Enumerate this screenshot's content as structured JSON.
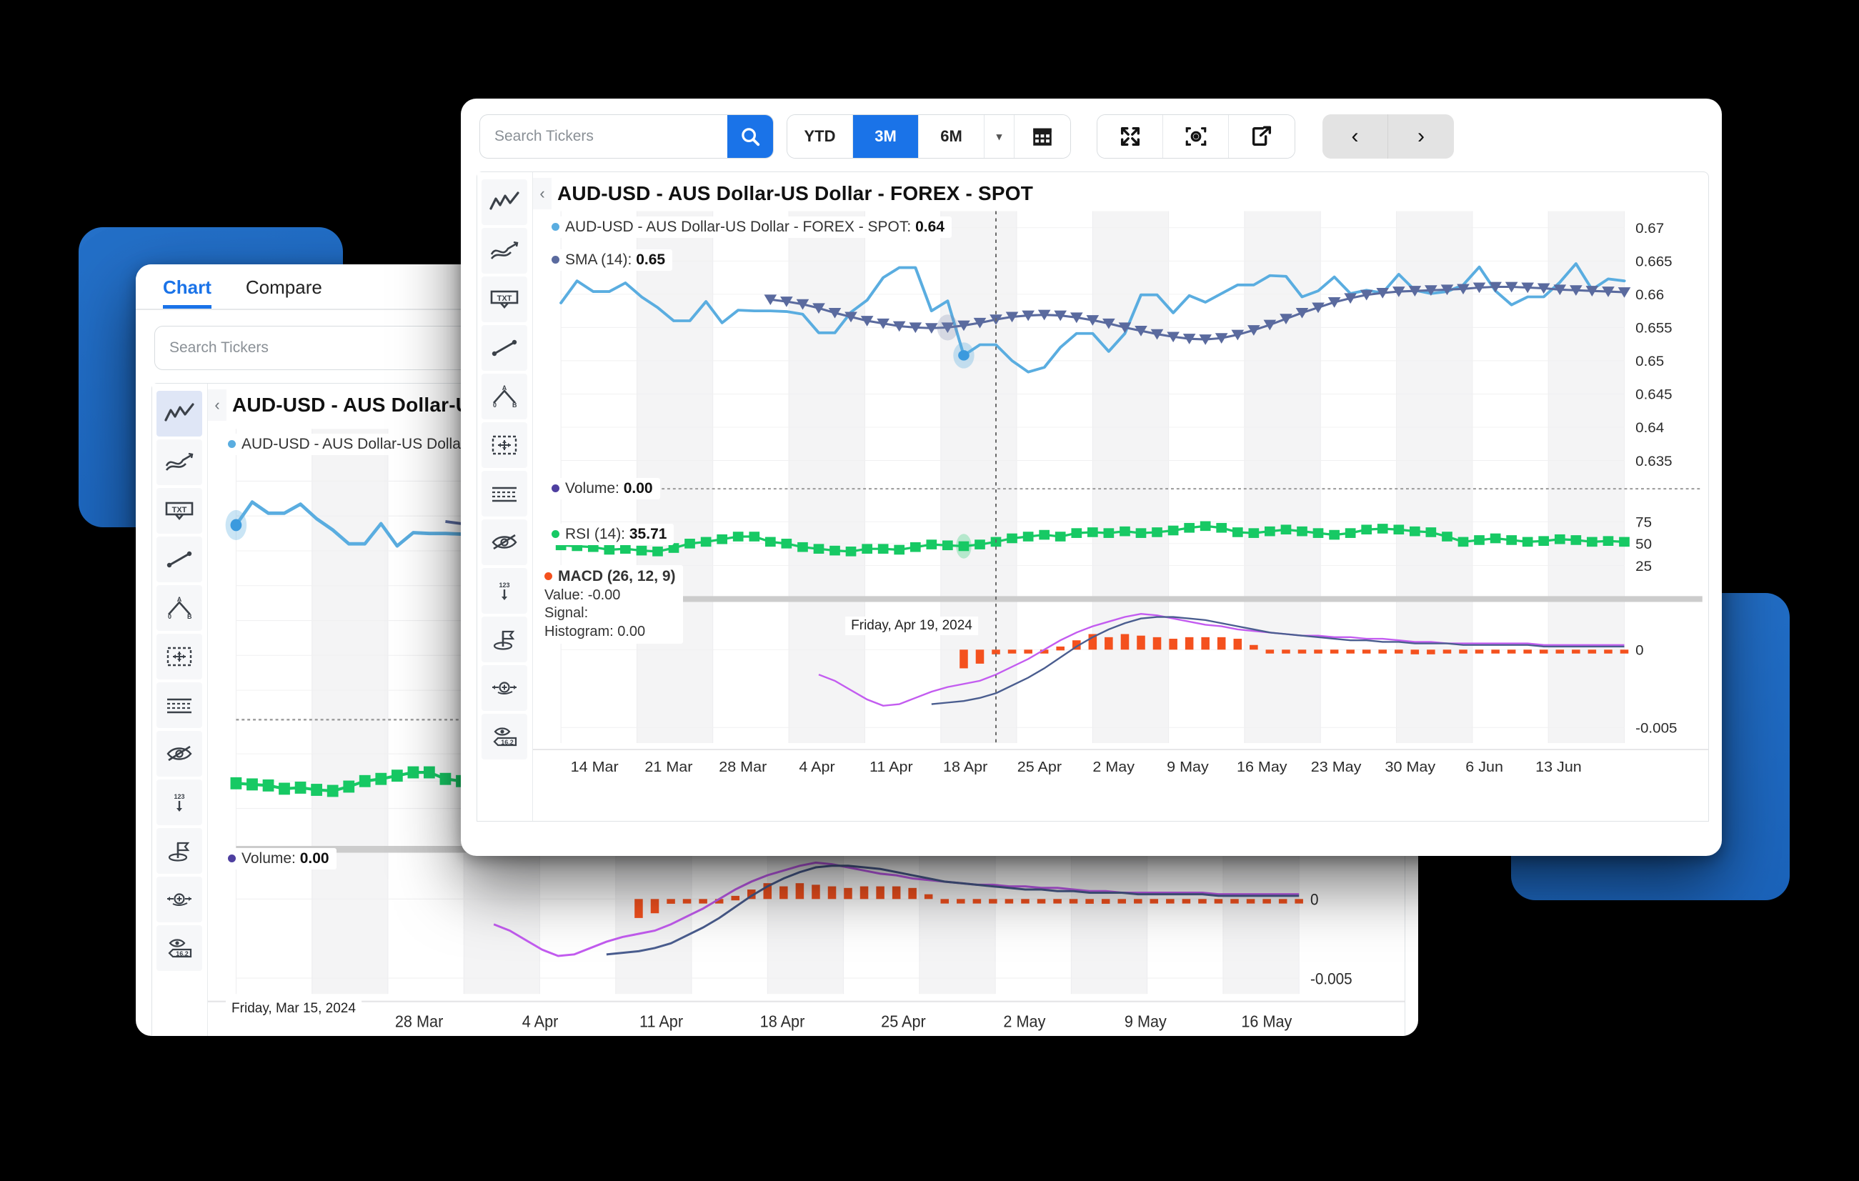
{
  "app": {
    "tabs": [
      {
        "label": "Chart",
        "active": true
      },
      {
        "label": "Compare",
        "active": false
      }
    ]
  },
  "search": {
    "placeholder": "Search Tickers",
    "value": "",
    "icon": "search-icon"
  },
  "toolbar": {
    "ranges": [
      {
        "label": "YTD",
        "active": false
      },
      {
        "label": "3M",
        "active": true
      },
      {
        "label": "6M",
        "active": false
      }
    ],
    "caret": "▾",
    "calendar_icon": "calendar-icon",
    "actions": [
      {
        "name": "fullscreen-icon",
        "label": ""
      },
      {
        "name": "camera-icon",
        "label": ""
      },
      {
        "name": "share-icon",
        "label": ""
      }
    ],
    "nav": [
      {
        "name": "prev-icon",
        "label": "‹"
      },
      {
        "name": "next-icon",
        "label": "›"
      }
    ]
  },
  "drawing_tools": [
    {
      "name": "line-chart-tool",
      "selected_front": false,
      "selected_back": true
    },
    {
      "name": "trend-line-tool",
      "selected_front": false,
      "selected_back": false
    },
    {
      "name": "text-annotation-tool",
      "selected_front": false,
      "selected_back": false
    },
    {
      "name": "segment-tool",
      "selected_front": false,
      "selected_back": false
    },
    {
      "name": "angle-tool",
      "selected_front": false,
      "selected_back": false
    },
    {
      "name": "move-selection-tool",
      "selected_front": false,
      "selected_back": false
    },
    {
      "name": "grid-lines-tool",
      "selected_front": false,
      "selected_back": false
    },
    {
      "name": "hide-drawings-tool",
      "selected_front": false,
      "selected_back": false
    },
    {
      "name": "numeric-axis-tool",
      "selected_front": false,
      "selected_back": false
    },
    {
      "name": "flag-marker-tool",
      "selected_front": false,
      "selected_back": false
    },
    {
      "name": "crosshair-tool",
      "selected_front": false,
      "selected_back": false
    },
    {
      "name": "value-readout-tool",
      "selected_front": false,
      "selected_back": false
    }
  ],
  "chart_title": "AUD-USD - AUS Dollar-US Dollar - FOREX - SPOT",
  "legend": {
    "price": {
      "label": "AUD-USD - AUS Dollar-US Dollar - FOREX - SPOT:",
      "value": "0.64",
      "color": "#5aade0"
    },
    "sma": {
      "label": "SMA (14):",
      "value": "0.65",
      "color": "#5a6a9e"
    },
    "volume": {
      "label": "Volume:",
      "value": "0.00",
      "color": "#4e3fa0"
    },
    "rsi": {
      "label": "RSI (14):",
      "value": "35.71",
      "color": "#17c964"
    },
    "macd": {
      "header": "MACD (26, 12, 9)",
      "value_line": "Value: -0.00",
      "signal_line": "Signal:",
      "histogram_line": "Histogram: 0.00",
      "color": "#f4511e"
    }
  },
  "cursor": {
    "front_date": "Friday, Apr 19, 2024",
    "back_date": "Friday, Mar 15, 2024"
  },
  "colors": {
    "accent": "#1a73e8",
    "price_line": "#5aade0",
    "sma_line": "#5a6a9e",
    "rsi": "#17c964",
    "macd_hist": "#f4511e",
    "macd_signal": "#c35cf0",
    "macd_line": "#4a5d8f",
    "plate_blue": "#2470c8"
  },
  "chart_data": {
    "type": "line",
    "title": "AUD-USD - AUS Dollar-US Dollar - FOREX - SPOT",
    "xlabel": "",
    "ylabel": "",
    "grid": true,
    "legend_position": "top-left",
    "panes": [
      {
        "id": "price",
        "ylim": [
          0.6325,
          0.6725
        ],
        "yticks": [
          "0.67",
          "0.665",
          "0.66",
          "0.655",
          "0.65",
          "0.645",
          "0.64",
          "0.635"
        ],
        "ytick_values": [
          0.67,
          0.665,
          0.66,
          0.655,
          0.65,
          0.645,
          0.64,
          0.635
        ],
        "series": [
          {
            "name": "AUD-USD - AUS Dollar-US Dollar - FOREX - SPOT",
            "color": "#5aade0",
            "marker": "none",
            "values": [
              0.6587,
              0.662,
              0.6604,
              0.6604,
              0.6617,
              0.6596,
              0.658,
              0.656,
              0.656,
              0.6589,
              0.6557,
              0.6576,
              0.6575,
              0.6575,
              0.6574,
              0.657,
              0.6542,
              0.6542,
              0.6573,
              0.6591,
              0.6625,
              0.664,
              0.664,
              0.6575,
              0.659,
              0.6508,
              0.6524,
              0.6524,
              0.65,
              0.6483,
              0.649,
              0.652,
              0.6541,
              0.6541,
              0.6514,
              0.6541,
              0.6599,
              0.6599,
              0.6572,
              0.6598,
              0.6588,
              0.6601,
              0.6614,
              0.6614,
              0.6628,
              0.6627,
              0.6596,
              0.6605,
              0.6626,
              0.6601,
              0.6606,
              0.6602,
              0.663,
              0.6606,
              0.6601,
              0.6604,
              0.6614,
              0.6641,
              0.6605,
              0.6584,
              0.6596,
              0.6596,
              0.6618,
              0.6646,
              0.6607,
              0.6623,
              0.662
            ]
          },
          {
            "name": "SMA (14)",
            "color": "#5a6a9e",
            "marker": "triangle-down",
            "values": [
              null,
              null,
              null,
              null,
              null,
              null,
              null,
              null,
              null,
              null,
              null,
              null,
              null,
              0.6592,
              0.6589,
              0.6585,
              0.6579,
              0.6572,
              0.6566,
              0.656,
              0.6556,
              0.6552,
              0.655,
              0.6549,
              0.655,
              0.6553,
              0.6557,
              0.6562,
              0.6566,
              0.6568,
              0.6569,
              0.6568,
              0.6565,
              0.6561,
              0.6556,
              0.655,
              0.6545,
              0.654,
              0.6536,
              0.6533,
              0.6532,
              0.6534,
              0.6539,
              0.6546,
              0.6554,
              0.6563,
              0.6572,
              0.658,
              0.6588,
              0.6594,
              0.6599,
              0.6602,
              0.6604,
              0.6605,
              0.6606,
              0.6607,
              0.6608,
              0.661,
              0.6611,
              0.6611,
              0.661,
              0.6609,
              0.6607,
              0.6606,
              0.6605,
              0.6604,
              0.6603
            ]
          }
        ]
      },
      {
        "id": "rsi",
        "ylim": [
          0,
          100
        ],
        "yticks": [
          "75",
          "50",
          "25"
        ],
        "ytick_values": [
          75,
          50,
          25
        ],
        "series": [
          {
            "name": "RSI (14)",
            "color": "#17c964",
            "marker": "square",
            "values": [
              48,
              47,
              46,
              43,
              44,
              42,
              41,
              45,
              50,
              52,
              55,
              58,
              58,
              52,
              50,
              46,
              44,
              42,
              41,
              44,
              44,
              43,
              46,
              49,
              48,
              47,
              49,
              52,
              56,
              58,
              60,
              58,
              62,
              63,
              62,
              64,
              62,
              63,
              65,
              68,
              70,
              68,
              63,
              62,
              64,
              66,
              64,
              62,
              60,
              62,
              66,
              67,
              66,
              64,
              63,
              58,
              52,
              54,
              56,
              54,
              52,
              53,
              55,
              54,
              52,
              53,
              52
            ]
          }
        ]
      },
      {
        "id": "macd",
        "ylim": [
          -0.006,
          0.004
        ],
        "yticks": [
          "0",
          "-0.005"
        ],
        "ytick_values": [
          0,
          -0.005
        ],
        "series": [
          {
            "name": "MACD Histogram",
            "color": "#f4511e",
            "type": "bar",
            "values": [
              null,
              null,
              null,
              null,
              null,
              null,
              null,
              null,
              null,
              null,
              null,
              null,
              null,
              null,
              null,
              null,
              null,
              null,
              null,
              null,
              null,
              null,
              null,
              null,
              null,
              -0.0012,
              -0.0009,
              -0.0003,
              -0.0002,
              -0.0002,
              -0.0002,
              0.0002,
              0.0006,
              0.001,
              0.0008,
              0.001,
              0.0009,
              0.0008,
              0.0007,
              0.0008,
              0.0008,
              0.0008,
              0.0007,
              0.0003,
              -0.0001,
              -0.0002,
              -0.0002,
              -0.0002,
              -0.0002,
              -0.0002,
              -0.0002,
              -0.0002,
              -0.0002,
              -0.0003,
              -0.0003,
              -0.0002,
              -0.0002,
              -0.0002,
              -0.0002,
              -0.0002,
              -0.0002,
              -0.0002,
              -0.0002,
              -0.0002,
              -0.0002,
              -0.0002,
              -0.0002
            ]
          },
          {
            "name": "MACD Signal",
            "color": "#c35cf0",
            "type": "line",
            "values": [
              null,
              null,
              null,
              null,
              null,
              null,
              null,
              null,
              null,
              null,
              null,
              null,
              null,
              null,
              null,
              null,
              -0.0016,
              -0.002,
              -0.0026,
              -0.0032,
              -0.0036,
              -0.0035,
              -0.0031,
              -0.0027,
              -0.0024,
              -0.0022,
              -0.002,
              -0.0016,
              -0.0011,
              -0.0006,
              0.0,
              0.0006,
              0.0011,
              0.0015,
              0.0018,
              0.0021,
              0.0023,
              0.0022,
              0.002,
              0.0018,
              0.0016,
              0.0015,
              0.0013,
              0.0012,
              0.0011,
              0.001,
              0.0009,
              0.0009,
              0.0008,
              0.0008,
              0.0007,
              0.0007,
              0.0006,
              0.0005,
              0.0005,
              0.0004,
              0.0004,
              0.0004,
              0.0004,
              0.0004,
              0.0004,
              0.0003,
              0.0003,
              0.0003,
              0.0003,
              0.0003,
              0.0003
            ]
          },
          {
            "name": "MACD Line",
            "color": "#4a5d8f",
            "type": "line",
            "values": [
              null,
              null,
              null,
              null,
              null,
              null,
              null,
              null,
              null,
              null,
              null,
              null,
              null,
              null,
              null,
              null,
              null,
              null,
              null,
              null,
              null,
              null,
              null,
              -0.0035,
              -0.0034,
              -0.0033,
              -0.0031,
              -0.0028,
              -0.0023,
              -0.0018,
              -0.0012,
              -0.0005,
              0.0002,
              0.0008,
              0.0013,
              0.0017,
              0.002,
              0.0021,
              0.0021,
              0.002,
              0.0019,
              0.0017,
              0.0015,
              0.0013,
              0.0011,
              0.001,
              0.0009,
              0.0008,
              0.0007,
              0.0006,
              0.0006,
              0.0005,
              0.0005,
              0.0004,
              0.0004,
              0.0004,
              0.0003,
              0.0003,
              0.0003,
              0.0003,
              0.0003,
              0.0002,
              0.0002,
              0.0002,
              0.0002,
              0.0002,
              0.0002
            ]
          }
        ]
      }
    ],
    "xticks_front": [
      "14 Mar",
      "21 Mar",
      "28 Mar",
      "4 Apr",
      "11 Apr",
      "18 Apr",
      "25 Apr",
      "2 May",
      "9 May",
      "16 May",
      "23 May",
      "30 May",
      "6 Jun",
      "13 Jun"
    ],
    "xticks_back": [
      "28 Mar",
      "4 Apr",
      "11 Apr",
      "18 Apr",
      "25 Apr",
      "2 May",
      "9 May",
      "16 May"
    ]
  }
}
